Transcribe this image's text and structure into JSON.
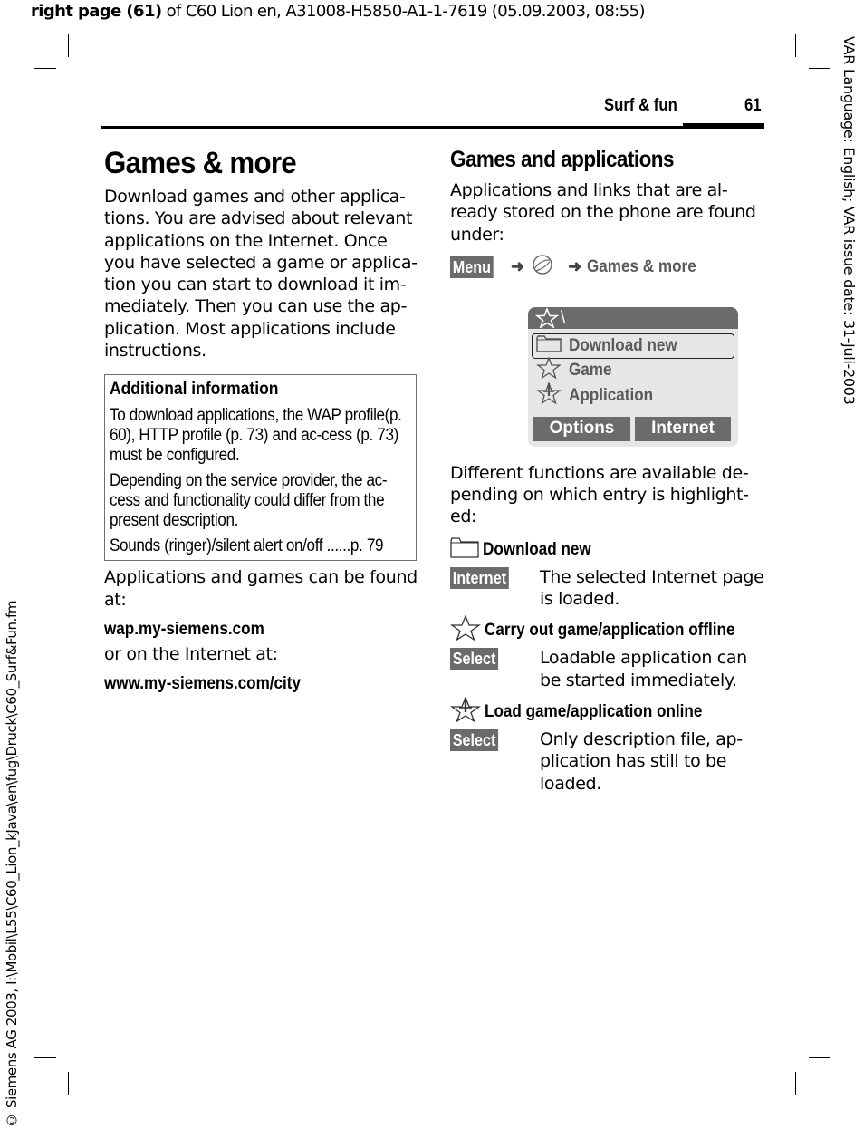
{
  "print_header": {
    "bold_part": "right page (61)",
    "rest": " of C60 Lion en, A31008-H5850-A1-1-7619 (05.09.2003, 08:55)"
  },
  "side_right": "VAR Language: English; VAR issue date: 31-Juli-2003",
  "side_left": "© Siemens AG 2003, I:\\Mobil\\L55\\C60_Lion_kJava\\en\\fug\\Druck\\C60_Surf&Fun.fm",
  "running_head": {
    "section": "Surf & fun",
    "page_number": "61"
  },
  "left_column": {
    "title": "Games & more",
    "intro": "Download games and other applica-tions. You are advised about relevant applications on the Internet. Once you have selected a game or applica-tion you can start to download it im-mediately. Then you can use the ap-plication. Most applications include instructions.",
    "info_box": {
      "title": "Additional information",
      "paragraphs": [
        "To download applications, the WAP profile(p. 60), HTTP profile (p. 73) and ac-cess (p. 73) must be configured.",
        "Depending on the service provider, the ac-cess and functionality could differ from the present description.",
        "Sounds (ringer)/silent alert on/off ......p. 79"
      ]
    },
    "found_at": "Applications and games can be found at:",
    "wap_url": "wap.my-siemens.com",
    "or_internet": "or on the Internet at:",
    "web_url": "www.my-siemens.com/city"
  },
  "right_column": {
    "subtitle": "Games and applications",
    "intro": "Applications and links that are al-ready stored on the phone are found under:",
    "menu_path": {
      "key": "Menu",
      "icon": "globe-icon",
      "target": "Games & more"
    },
    "phone_screen": {
      "title_icon": "star-icon",
      "title_text": "\\",
      "rows": [
        {
          "icon": "folder-icon",
          "label": "Download new",
          "selected": true
        },
        {
          "icon": "star-outline-icon",
          "label": "Game",
          "selected": false
        },
        {
          "icon": "star-download-icon",
          "label": "Application",
          "selected": false
        }
      ],
      "softkeys": {
        "left": "Options",
        "right": "Internet"
      }
    },
    "functions_intro": "Different functions are available de-pending on which entry is highlight-ed:",
    "entries": [
      {
        "icon": "folder-icon",
        "heading": "Download new",
        "key": "Internet",
        "description": "The selected Internet page is loaded."
      },
      {
        "icon": "star-outline-icon",
        "heading": "Carry out game/application offline",
        "key": "Select",
        "description": "Loadable application can be started immediately."
      },
      {
        "icon": "star-download-icon",
        "heading": "Load game/application online",
        "key": "Select",
        "description": "Only description file, ap-plication has still to be loaded."
      }
    ]
  }
}
